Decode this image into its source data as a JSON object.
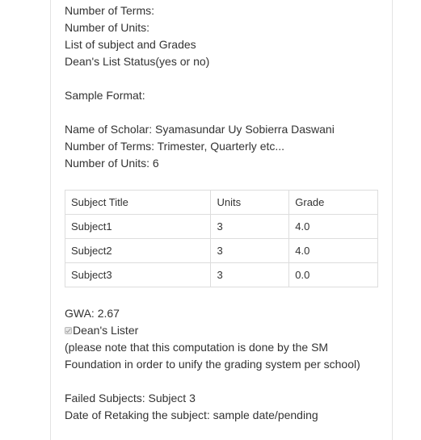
{
  "intro_lines": [
    "Number of Terms:",
    "Number of Units:",
    "List of subject and Grades",
    "Dean's List Status(yes or no)"
  ],
  "sample_format_label": "Sample Format:",
  "sample_lines": [
    "Name of Scholar: Syamasundar Uy Sobierra Daswani",
    "Number of Terms: Trimester, Quarterly etc...",
    "Number of Units: 6"
  ],
  "table": {
    "headers": [
      "Subject Title",
      "Units",
      "Grade"
    ],
    "rows": [
      [
        "Subject1",
        "3",
        "4.0"
      ],
      [
        "Subject2",
        "3",
        "4.0"
      ],
      [
        "Subject3",
        "3",
        "0.0"
      ]
    ]
  },
  "gwa": "GWA: 2.67",
  "deans_lister": {
    "label": "Dean's Lister",
    "checked": true
  },
  "note_lines": [
    "(please note that this computation is done by the SM",
    "Foundation in order to unify the grading system per school)"
  ],
  "failed_lines": [
    "Failed Subjects: Subject 3",
    "Date of Retaking the subject: sample date/pending"
  ]
}
